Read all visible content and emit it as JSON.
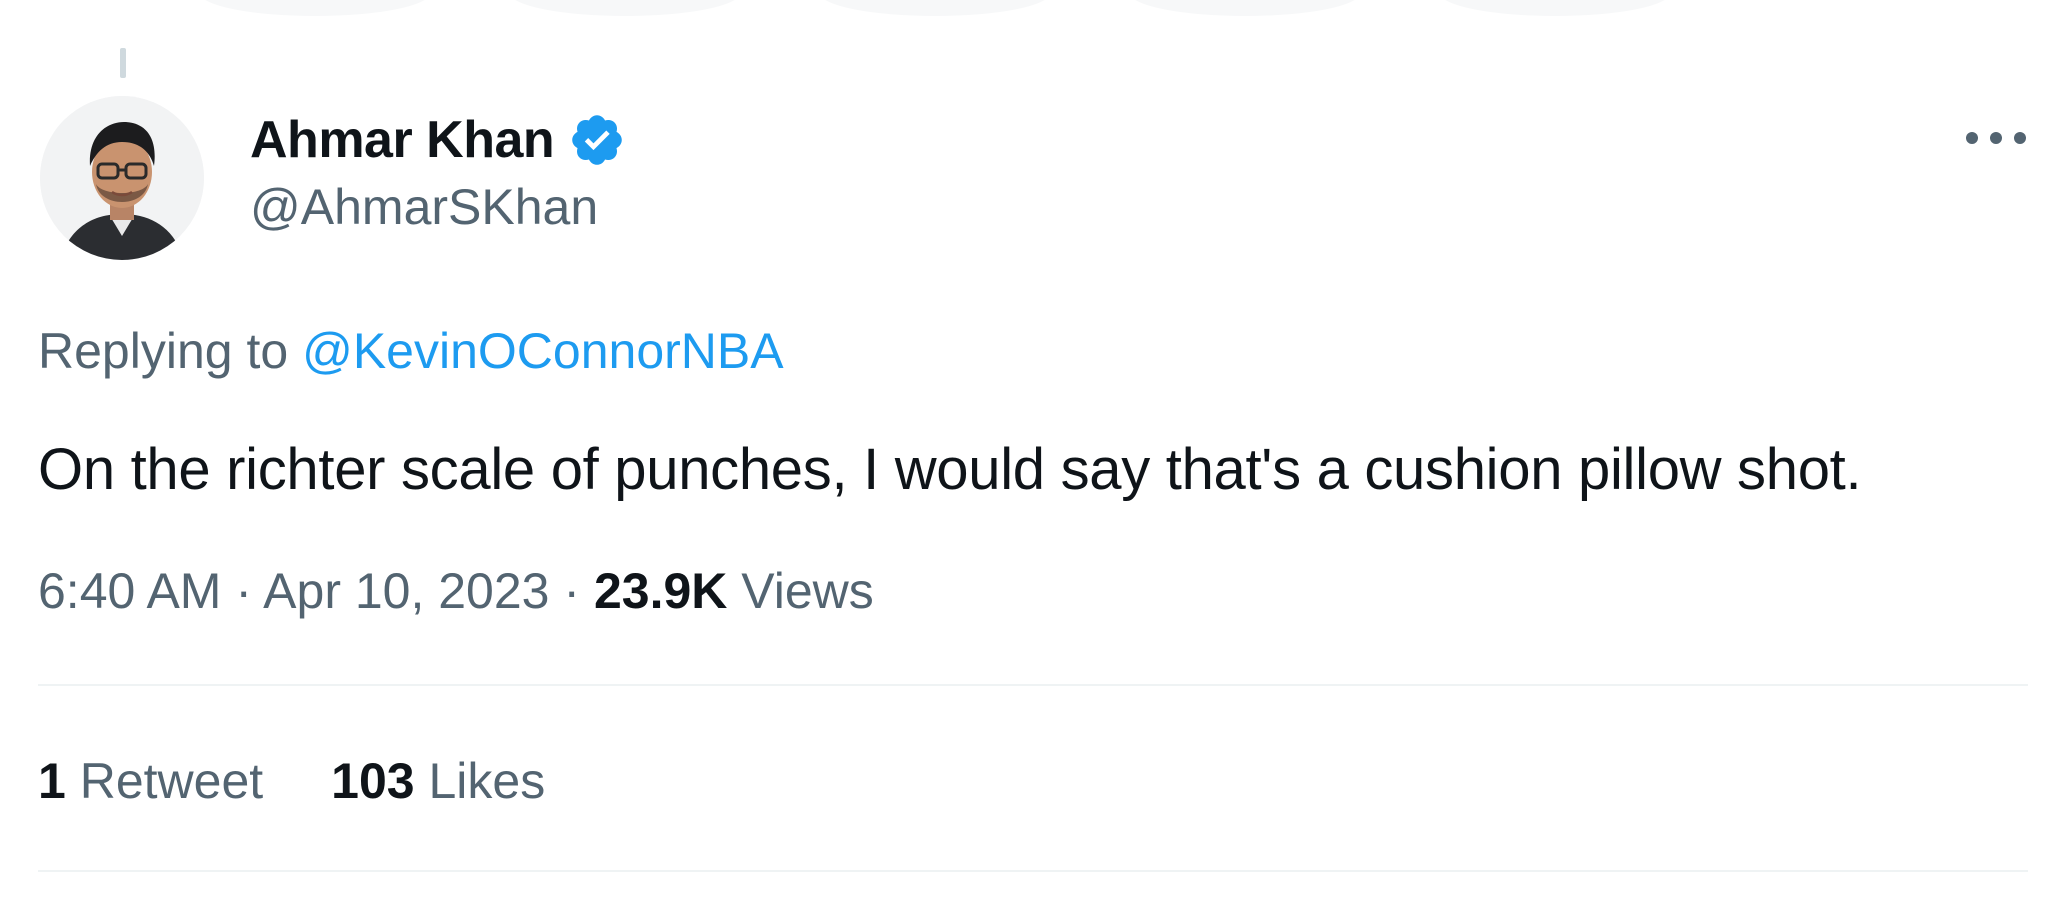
{
  "author": {
    "display_name": "Ahmar Khan",
    "handle": "@AhmarSKhan",
    "verified_icon": "verified-badge-icon",
    "avatar_icon": "profile-avatar"
  },
  "reply": {
    "prefix": "Replying to",
    "mention": "@KevinOConnorNBA"
  },
  "tweet": {
    "text": "On the richter scale of punches, I would say that's a cushion pillow shot."
  },
  "meta": {
    "time": "6:40 AM",
    "separator": "·",
    "date": "Apr 10, 2023",
    "views_count": "23.9K",
    "views_label": "Views"
  },
  "stats": {
    "retweets_count": "1",
    "retweets_label": "Retweet",
    "likes_count": "103",
    "likes_label": "Likes"
  },
  "colors": {
    "accent": "#1d9bf0",
    "text_primary": "#0f1419",
    "text_secondary": "#536471",
    "divider": "#eff3f4"
  },
  "icons": {
    "more": "more-options-icon"
  }
}
